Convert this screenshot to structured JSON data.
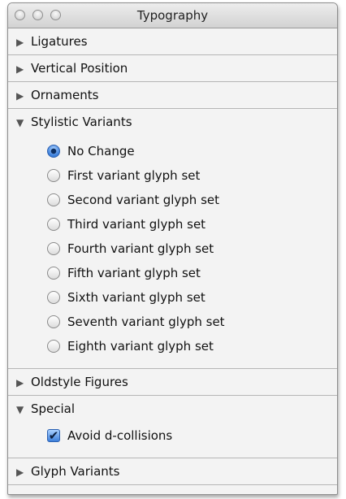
{
  "window": {
    "title": "Typography"
  },
  "sections": {
    "ligatures": {
      "label": "Ligatures",
      "expanded": false
    },
    "vertical_position": {
      "label": "Vertical Position",
      "expanded": false
    },
    "ornaments": {
      "label": "Ornaments",
      "expanded": false
    },
    "stylistic_variants": {
      "label": "Stylistic Variants",
      "expanded": true,
      "options": [
        {
          "label": "No Change",
          "selected": true
        },
        {
          "label": "First variant glyph set",
          "selected": false
        },
        {
          "label": "Second variant glyph set",
          "selected": false
        },
        {
          "label": "Third variant glyph set",
          "selected": false
        },
        {
          "label": "Fourth variant glyph set",
          "selected": false
        },
        {
          "label": "Fifth variant glyph set",
          "selected": false
        },
        {
          "label": "Sixth variant glyph set",
          "selected": false
        },
        {
          "label": "Seventh variant glyph set",
          "selected": false
        },
        {
          "label": "Eighth variant glyph set",
          "selected": false
        }
      ]
    },
    "oldstyle_figures": {
      "label": "Oldstyle Figures",
      "expanded": false
    },
    "special": {
      "label": "Special",
      "expanded": true,
      "avoid_d_collisions": {
        "label": "Avoid d-collisions",
        "checked": true
      }
    },
    "glyph_variants": {
      "label": "Glyph Variants",
      "expanded": false
    }
  },
  "icons": {
    "collapsed": "▶",
    "expanded": "▼",
    "check": "✔"
  }
}
